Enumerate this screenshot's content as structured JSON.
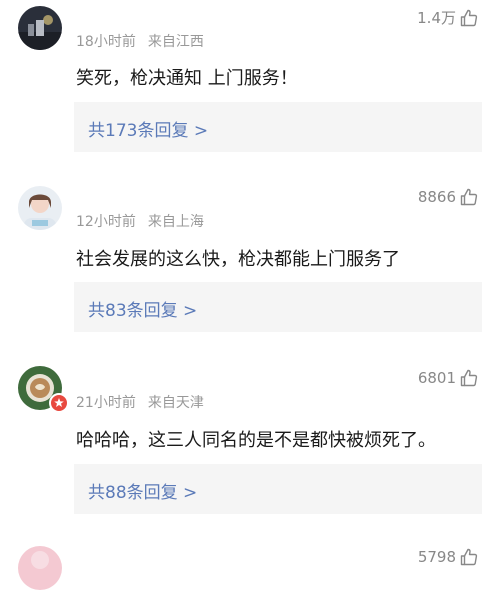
{
  "comments": [
    {
      "time": "18小时前",
      "location": "来自江西",
      "likes": "1.4万",
      "text": "笑死，枪决通知 上门服务！",
      "replies": "共173条回复 >"
    },
    {
      "time": "12小时前",
      "location": "来自上海",
      "likes": "8866",
      "text": "社会发展的这么快，枪决都能上门服务了",
      "replies": "共83条回复 >"
    },
    {
      "time": "21小时前",
      "location": "来自天津",
      "likes": "6801",
      "text": "哈哈哈，这三人同名的是不是都快被烦死了。",
      "replies": "共88条回复 >"
    },
    {
      "likes": "5798"
    }
  ],
  "icons": {
    "like": "thumbs-up-icon",
    "vip_badge": "vip-badge-icon"
  },
  "colors": {
    "link": "#5b7ab8",
    "meta": "#999999",
    "reply_bg": "#f5f5f5",
    "badge": "#e8493f"
  }
}
